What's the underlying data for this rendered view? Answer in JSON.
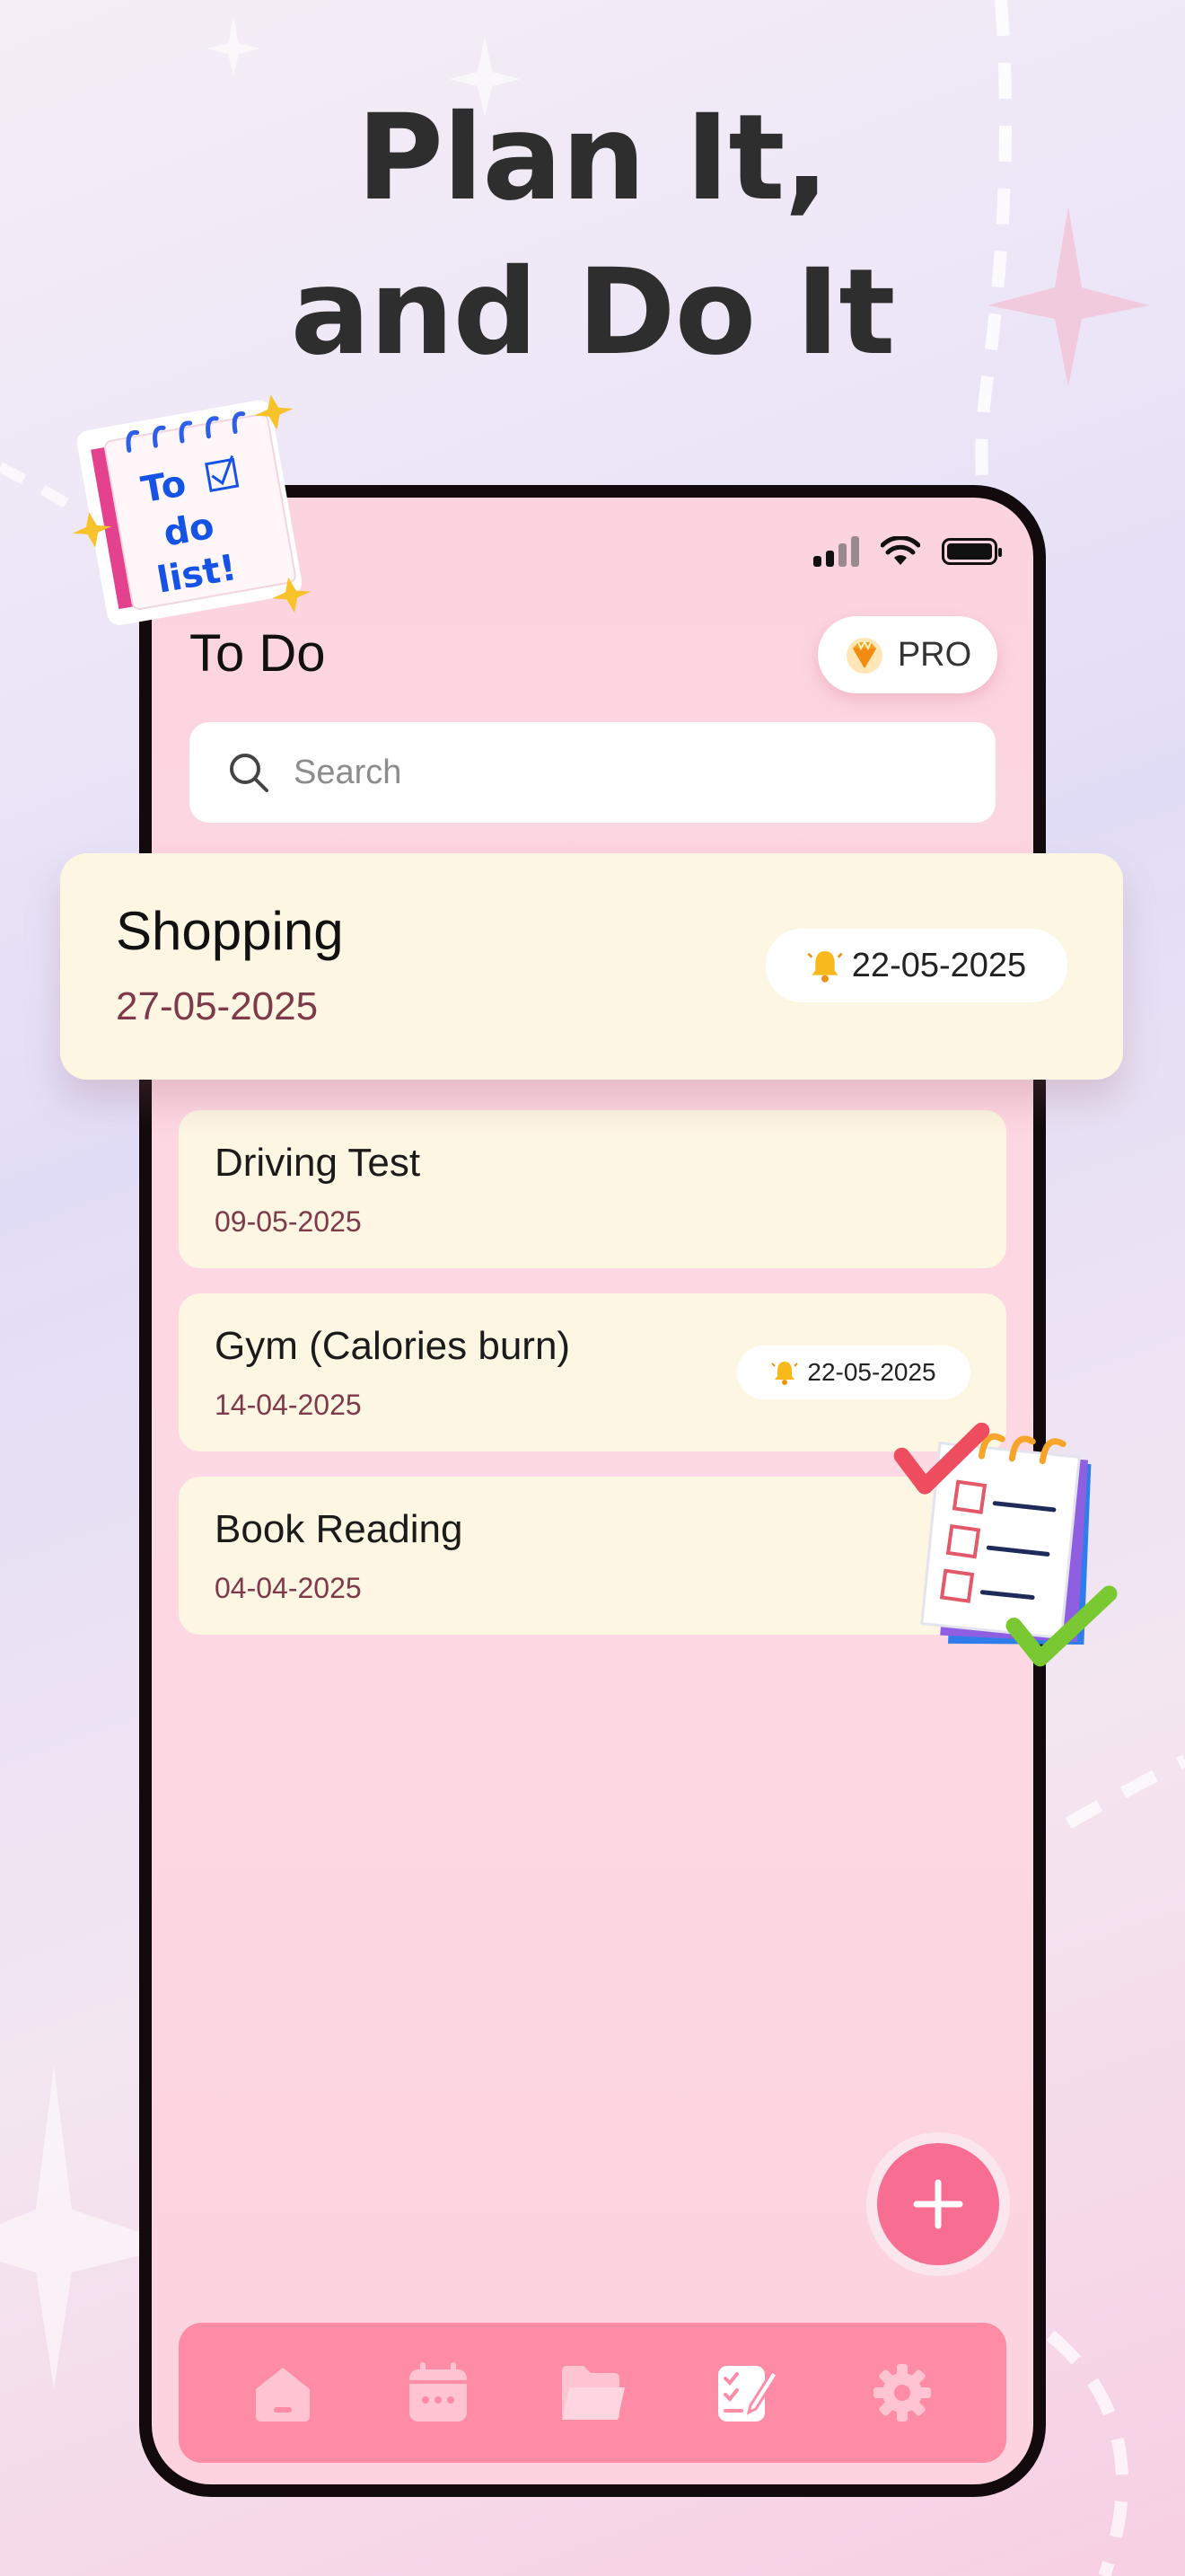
{
  "headline": {
    "line1": "Plan It,",
    "line2": "and Do It"
  },
  "sticker_todo": {
    "lettering": [
      "To",
      "do",
      "list!"
    ]
  },
  "header": {
    "title": "To Do",
    "pro_label": "PRO"
  },
  "search": {
    "placeholder": "Search"
  },
  "featured_task": {
    "title": "Shopping",
    "date": "27-05-2025",
    "reminder": "22-05-2025"
  },
  "tasks": [
    {
      "title": "Driving Test",
      "date": "09-05-2025",
      "reminder": ""
    },
    {
      "title": "Gym (Calories burn)",
      "date": "14-04-2025",
      "reminder": "22-05-2025"
    },
    {
      "title": "Book Reading",
      "date": "04-04-2025",
      "reminder": ""
    }
  ],
  "nav": {
    "items": [
      "home-icon",
      "calendar-icon",
      "folder-icon",
      "todo-icon",
      "settings-icon"
    ],
    "active": "todo-icon"
  },
  "colors": {
    "accent": "#f86e93",
    "navbar": "#ff8ca6",
    "card": "#fdf6e3",
    "date_text": "#7e3a4a",
    "screen_bg": "#fdd9e3"
  }
}
